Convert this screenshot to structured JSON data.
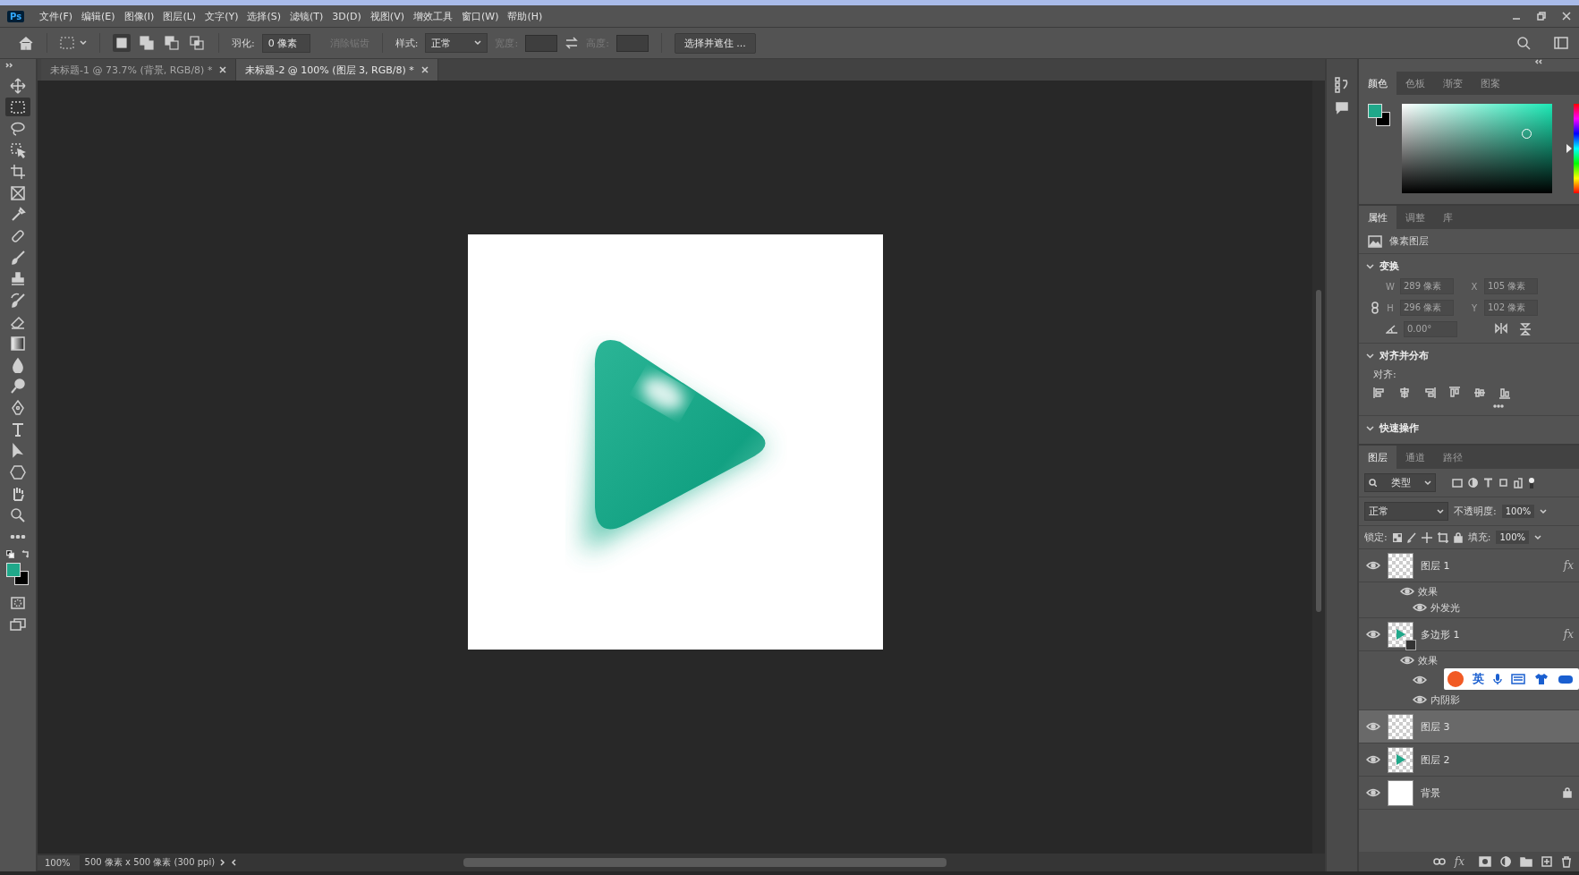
{
  "app_logo": "Ps",
  "menu_bar": {
    "items": [
      "文件(F)",
      "编辑(E)",
      "图像(I)",
      "图层(L)",
      "文字(Y)",
      "选择(S)",
      "滤镜(T)",
      "3D(D)",
      "视图(V)",
      "增效工具",
      "窗口(W)",
      "帮助(H)"
    ]
  },
  "options_bar": {
    "modes": [
      {
        "kind": "new",
        "selected": true
      },
      {
        "kind": "add",
        "selected": false
      },
      {
        "kind": "subtract",
        "selected": false
      },
      {
        "kind": "intersect",
        "selected": false
      }
    ],
    "feather_label": "羽化:",
    "feather_value": "0 像素",
    "antialias_label": "消除锯齿",
    "antialias_disabled": true,
    "style_label": "样式:",
    "style_value": "正常",
    "width_label": "宽度:",
    "height_label": "高度:",
    "size_disabled": true,
    "select_mask_button": "选择并遮住 ..."
  },
  "document_tabs": [
    {
      "label": "未标题-1 @ 73.7% (背景, RGB/8) *",
      "selected": false
    },
    {
      "label": "未标题-2 @ 100% (图层 3, RGB/8) *",
      "selected": true
    }
  ],
  "tools": [
    {
      "kind": "move",
      "selected": false
    },
    {
      "kind": "marquee",
      "selected": true
    },
    {
      "kind": "lasso",
      "selected": false
    },
    {
      "kind": "object-select",
      "selected": false
    },
    {
      "kind": "crop",
      "selected": false
    },
    {
      "kind": "frame",
      "selected": false
    },
    {
      "kind": "eyedropper",
      "selected": false
    },
    {
      "kind": "healing",
      "selected": false
    },
    {
      "kind": "brush",
      "selected": false
    },
    {
      "kind": "stamp",
      "selected": false
    },
    {
      "kind": "history-brush",
      "selected": false
    },
    {
      "kind": "eraser",
      "selected": false
    },
    {
      "kind": "gradient",
      "selected": false
    },
    {
      "kind": "blur",
      "selected": false
    },
    {
      "kind": "dodge",
      "selected": false
    },
    {
      "kind": "pen",
      "selected": false
    },
    {
      "kind": "type",
      "selected": false
    },
    {
      "kind": "path-select",
      "selected": false
    },
    {
      "kind": "shape",
      "selected": false
    },
    {
      "kind": "hand",
      "selected": false
    },
    {
      "kind": "zoom",
      "selected": false
    },
    {
      "kind": "more",
      "selected": false
    }
  ],
  "status_bar": {
    "zoom": "100%",
    "document_info": "500 像素 x 500 像素 (300 ppi)"
  },
  "color_panel": {
    "hue_slider": {
      "level": 0.5
    },
    "tabs": [
      {
        "label": "颜色",
        "selected": true
      },
      {
        "label": "色板",
        "selected": false
      },
      {
        "label": "渐变",
        "selected": false
      },
      {
        "label": "图案",
        "selected": false
      }
    ]
  },
  "properties_panel": {
    "tabs": [
      {
        "label": "属性",
        "selected": true
      },
      {
        "label": "调整",
        "selected": false
      },
      {
        "label": "库",
        "selected": false
      }
    ],
    "layer_type": "像素图层",
    "transform": {
      "title": "变换",
      "expanded": true,
      "fields": [
        {
          "label": "W",
          "value": "289 像素"
        },
        {
          "label": "X",
          "value": "105 像素"
        },
        {
          "label": "H",
          "value": "296 像素"
        },
        {
          "label": "Y",
          "value": "102 像素"
        }
      ],
      "angle": "0.00°",
      "disabled": true
    },
    "align": {
      "title": "对齐并分布",
      "expanded": true,
      "label": "对齐:"
    },
    "quick_actions": {
      "title": "快速操作",
      "expanded": true
    }
  },
  "layers_panel": {
    "tabs": [
      {
        "label": "图层",
        "selected": true
      },
      {
        "label": "通道",
        "selected": false
      },
      {
        "label": "路径",
        "selected": false
      }
    ],
    "filter": "类型",
    "blend_mode": "正常",
    "opacity_label": "不透明度:",
    "opacity": "100%",
    "lock_label": "锁定:",
    "fill_label": "填充:",
    "fill": "100%",
    "layers": [
      {
        "name": "图层 1",
        "kind": "transparent",
        "visible": true,
        "selected": false,
        "fx": "fx",
        "effects": {
          "label": "效果",
          "items": [
            {
              "name": "外发光"
            }
          ]
        }
      },
      {
        "name": "多边形 1",
        "kind": "shape",
        "visible": true,
        "selected": false,
        "fx": "fx",
        "effects": {
          "label": "效果",
          "items": [
            {
              "covered": true
            },
            {
              "name": "内阴影"
            }
          ]
        }
      },
      {
        "name": "图层 3",
        "kind": "transparent",
        "visible": true,
        "selected": true
      },
      {
        "name": "图层 2",
        "kind": "triangle",
        "visible": true,
        "selected": false
      },
      {
        "name": "背景",
        "kind": "white",
        "visible": true,
        "selected": false,
        "locked": true
      }
    ],
    "footer_fx": "fx"
  },
  "ime_toolbar": {
    "label": "英"
  }
}
